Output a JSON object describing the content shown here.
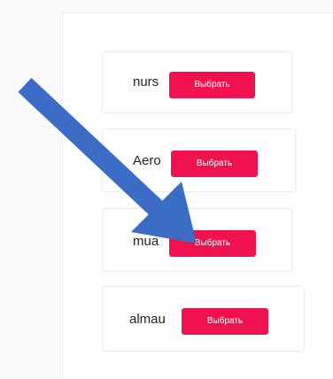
{
  "colors": {
    "button_bg": "#f0114f",
    "arrow": "#3b6cc6"
  },
  "items": [
    {
      "label": "nurs",
      "button_label": "Выбрать"
    },
    {
      "label": "Aero",
      "button_label": "Выбрать"
    },
    {
      "label": "mua",
      "button_label": "Выбрать"
    },
    {
      "label": "almau",
      "button_label": "Выбрать"
    }
  ],
  "overlay": {
    "icon": "arrow-pointer-icon"
  }
}
